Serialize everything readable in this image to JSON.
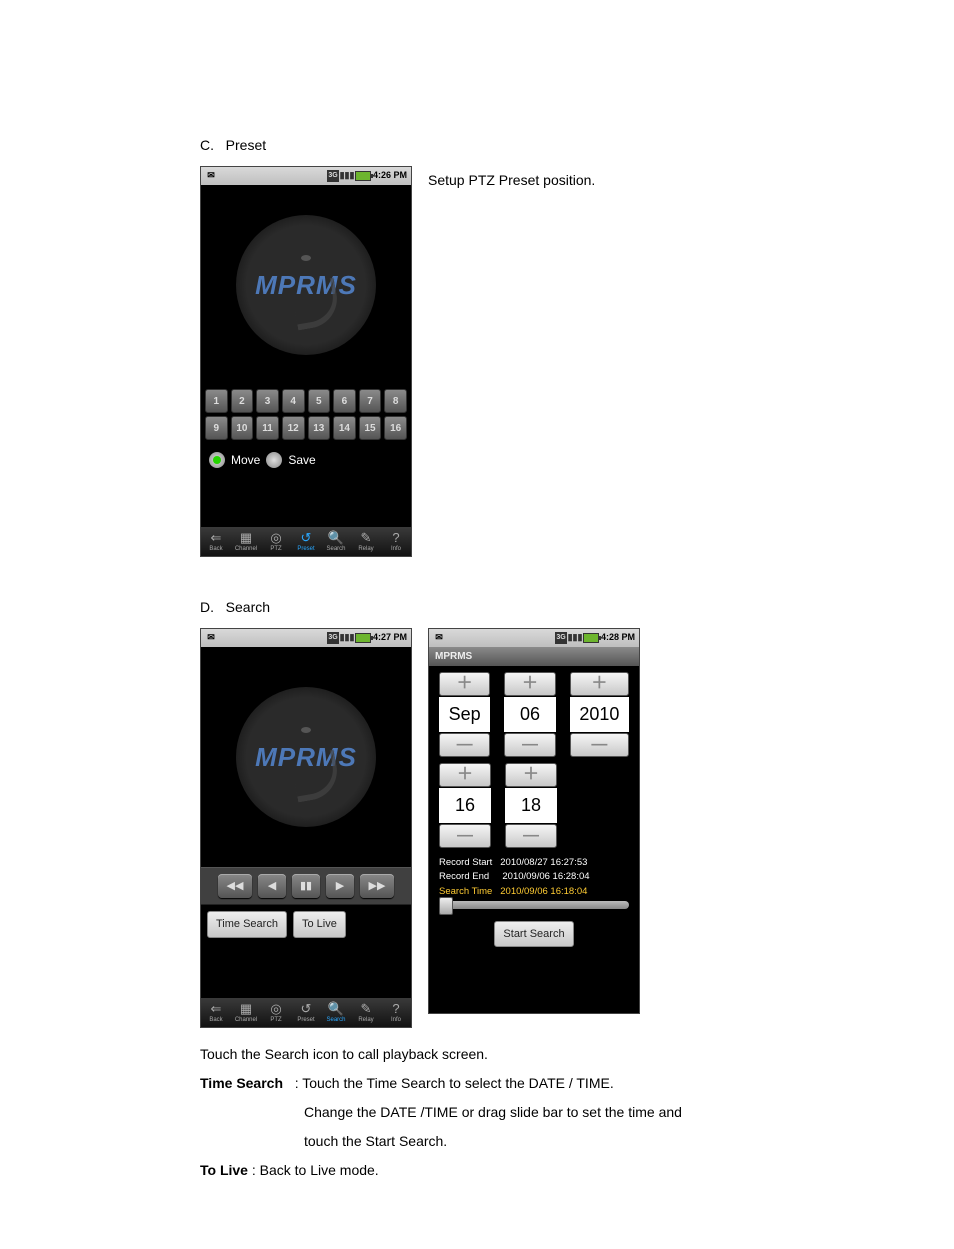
{
  "sections": {
    "c": {
      "letter": "C.",
      "title": "Preset",
      "caption": "Setup PTZ Preset position."
    },
    "d": {
      "letter": "D.",
      "title": "Search"
    }
  },
  "statusbar": {
    "time1": "4:26 PM",
    "time2": "4:27 PM",
    "time3": "4:28 PM",
    "network_icon": "3G",
    "signal_icon": "▮▮▮",
    "msg_icon": "✉"
  },
  "app_logo": "MPRMS",
  "mprms_bar": "MPRMS",
  "preset": {
    "numbers_row1": [
      "1",
      "2",
      "3",
      "4",
      "5",
      "6",
      "7",
      "8"
    ],
    "numbers_row2": [
      "9",
      "10",
      "11",
      "12",
      "13",
      "14",
      "15",
      "16"
    ],
    "move_label": "Move",
    "save_label": "Save"
  },
  "nav": {
    "items": [
      "Back",
      "Channel",
      "PTZ",
      "Preset",
      "Search",
      "Relay",
      "Info"
    ],
    "icons": [
      "⇐",
      "▦",
      "◎",
      "↺",
      "🔍",
      "✎",
      "?"
    ],
    "active_preset_idx": 3,
    "active_search_idx": 4
  },
  "playback": {
    "rewind": "◀◀",
    "back": "◀",
    "pause": "▮▮",
    "fwd": "▶",
    "ffwd": "▶▶",
    "time_search_btn": "Time Search",
    "to_live_btn": "To Live"
  },
  "search_screen": {
    "date": {
      "month": "Sep",
      "day": "06",
      "year": "2010"
    },
    "time": {
      "hour": "16",
      "minute": "18"
    },
    "plus": "＋",
    "minus": "—",
    "record_start_label": "Record Start",
    "record_start_value": "2010/08/27 16:27:53",
    "record_end_label": "Record End",
    "record_end_value": "2010/09/06 16:28:04",
    "search_time_label": "Search Time",
    "search_time_value": "2010/09/06 16:18:04",
    "start_search_btn": "Start Search"
  },
  "body": {
    "line1": "Touch the Search icon to call playback screen.",
    "time_search_label": "Time Search",
    "time_search_text": ": Touch the Time Search to select the DATE / TIME.",
    "time_search_text2": "Change the DATE /TIME or drag slide bar to set the time and",
    "time_search_text3": "touch the Start Search.",
    "to_live_label": "To Live",
    "to_live_text": " : Back to Live mode."
  }
}
